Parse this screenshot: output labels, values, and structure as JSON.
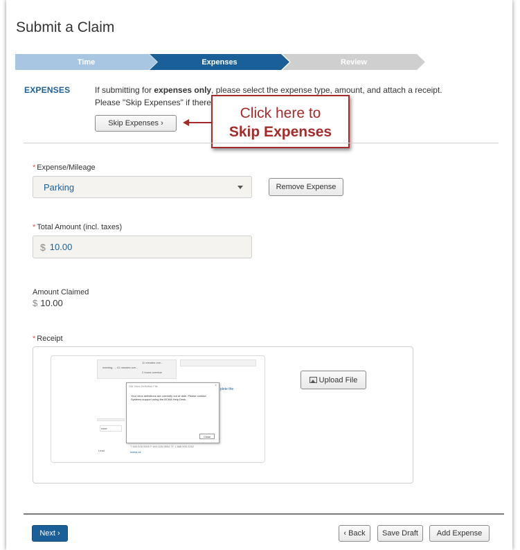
{
  "page": {
    "title": "Submit a Claim"
  },
  "stepper": {
    "steps": [
      {
        "label": "Time",
        "state": "complete"
      },
      {
        "label": "Expenses",
        "state": "active"
      },
      {
        "label": "Review",
        "state": "pending"
      }
    ]
  },
  "section": {
    "label": "EXPENSES",
    "instruction_line1_prefix": "If submitting for ",
    "instruction_line1_bold": "expenses only",
    "instruction_line1_suffix": ", please select the expense type, amount, and attach a receipt.",
    "instruction_line2": "Please \"Skip Expenses\" if there",
    "skip_button": "Skip Expenses ›"
  },
  "callout": {
    "line1": "Click here to",
    "line2": "Skip Expenses"
  },
  "form": {
    "expense_label": "Expense/Mileage",
    "expense_value": "Parking",
    "remove_button": "Remove Expense",
    "total_label": "Total Amount (incl. taxes)",
    "currency_symbol": "$",
    "total_value": "10.00",
    "claimed_label": "Amount Claimed",
    "claimed_value": "10.00",
    "receipt_label": "Receipt",
    "required_mark": "*",
    "upload_button": "Upload File"
  },
  "receipt_thumbnail": {
    "list_lines": [
      "11 minutes ove...",
      "meeting, ... 41 minutes ove...",
      "2 hours overdue"
    ],
    "dialog_title": "Old Virus Definition File",
    "dialog_close_x": "×",
    "dialog_message": "Your virus definitions are currently out of date. Please contact Systems support using the BCMA Help Desk.",
    "dialog_close_button": "Close",
    "link_text": "plete the",
    "phone_line": "T 604 628 0900  F 604 628 0854  TF 1 888 905 2262",
    "field_text": "ease",
    "side_text": "Lead",
    "small_link": "sreba.ca"
  },
  "footer": {
    "next_button": "Next ›",
    "back_button": "‹ Back",
    "draft_button": "Save Draft",
    "add_button": "Add Expense"
  },
  "colors": {
    "primary": "#1a5f98",
    "step_complete": "#a8c6e2",
    "step_pending": "#cfcfcf",
    "callout": "#a52a2a",
    "required": "#d9534f"
  }
}
